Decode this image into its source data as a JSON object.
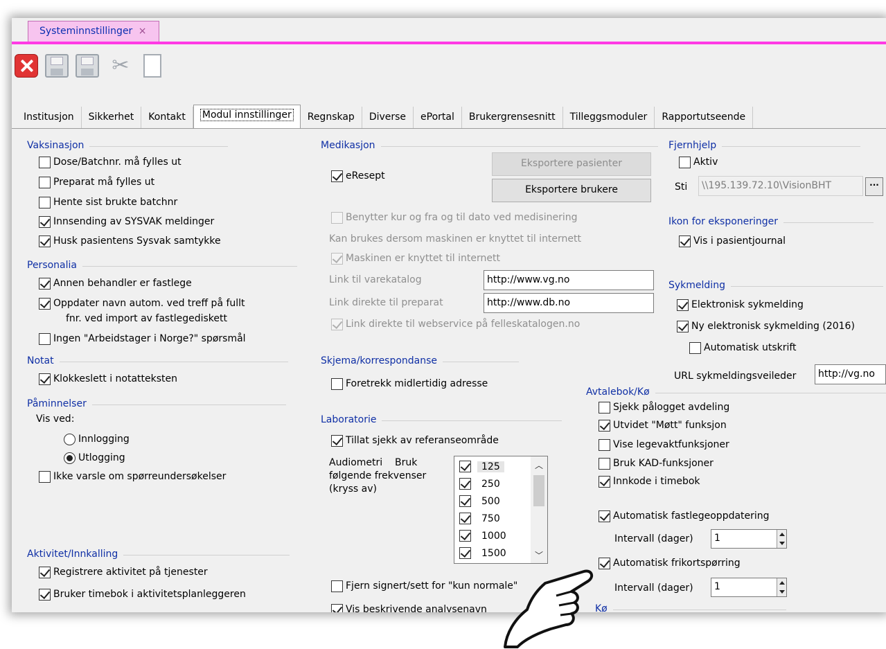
{
  "window": {
    "tab_title": "Systeminnstillinger",
    "tab_close": "×"
  },
  "toolbar": {
    "close_icon": "close-icon",
    "save_icon": "save-icon",
    "save_close_icon": "save-close-icon",
    "cut_icon": "scissors-icon",
    "new_icon": "new-document-icon"
  },
  "tabs": [
    {
      "label": "Institusjon"
    },
    {
      "label": "Sikkerhet"
    },
    {
      "label": "Kontakt"
    },
    {
      "label": "Modul innstillinger"
    },
    {
      "label": "Regnskap"
    },
    {
      "label": "Diverse"
    },
    {
      "label": "ePortal"
    },
    {
      "label": "Brukergrensesnitt"
    },
    {
      "label": "Tilleggsmoduler"
    },
    {
      "label": "Rapportutseende"
    }
  ],
  "vaksinasjon": {
    "title": "Vaksinasjon",
    "items": [
      {
        "label": "Dose/Batchnr. må fylles ut",
        "checked": false
      },
      {
        "label": "Preparat må fylles ut",
        "checked": false
      },
      {
        "label": "Hente sist brukte batchnr",
        "checked": false
      },
      {
        "label": "Innsending av SYSVAK meldinger",
        "checked": true
      },
      {
        "label": "Husk pasientens Sysvak samtykke",
        "checked": true
      }
    ]
  },
  "personalia": {
    "title": "Personalia",
    "items": [
      {
        "label": "Annen behandler er fastlege",
        "checked": true
      },
      {
        "label": "Oppdater navn autom. ved treff på fullt",
        "label2": "fnr. ved import av fastlegediskett",
        "checked": true
      },
      {
        "label": "Ingen \"Arbeidstager i Norge?\" spørsmål",
        "checked": false
      }
    ]
  },
  "notat": {
    "title": "Notat",
    "items": [
      {
        "label": "Klokkeslett i notatteksten",
        "checked": true
      }
    ]
  },
  "paminnelser": {
    "title": "Påminnelser",
    "vis_ved": "Vis ved:",
    "radios": [
      {
        "label": "Innlogging",
        "checked": false
      },
      {
        "label": "Utlogging",
        "checked": true
      }
    ],
    "ikke_varsle": "Ikke varsle om spørreundersøkelser"
  },
  "aktivitet": {
    "title": "Aktivitet/Innkalling",
    "items": [
      {
        "label": "Registrere aktivitet på tjenester",
        "checked": true
      },
      {
        "label": "Bruker timebok i aktivitetsplanleggeren",
        "checked": true
      }
    ]
  },
  "medikasjon": {
    "title": "Medikasjon",
    "eresept": "eResept",
    "export_pasienter": "Eksportere pasienter",
    "export_brukere": "Eksportere brukere",
    "kur": "Benytter kur og fra og til dato ved medisinering",
    "internett_note": "Kan brukes dersom maskinen er knyttet til internett",
    "internett": "Maskinen er knyttet til internett",
    "link_varekatalog_label": "Link til varekatalog",
    "link_varekatalog_value": "http://www.vg.no",
    "link_preparat_label": "Link direkte til preparat",
    "link_preparat_value": "http://www.db.no",
    "webservice": "Link direkte til webservice på felleskatalogen.no"
  },
  "skjema": {
    "title": "Skjema/korrespondanse",
    "foretrekk": "Foretrekk midlertidig adresse"
  },
  "laboratorie": {
    "title": "Laboratorie",
    "tillat": "Tillat sjekk av referanseområde",
    "audiometri_1": "Audiometri    Bruk",
    "audiometri_2": "følgende frekvenser",
    "audiometri_3": "(kryss av)",
    "frekvenser": [
      {
        "label": "125",
        "checked": true
      },
      {
        "label": "250",
        "checked": true
      },
      {
        "label": "500",
        "checked": true
      },
      {
        "label": "750",
        "checked": true
      },
      {
        "label": "1000",
        "checked": true
      },
      {
        "label": "1500",
        "checked": true
      }
    ],
    "fjern": "Fjern signert/sett for \"kun normale\"",
    "vis_beskrivende": "Vis beskrivende analysenavn"
  },
  "fjernhjelp": {
    "title": "Fjernhjelp",
    "aktiv": "Aktiv",
    "sti_label": "Sti",
    "sti_value": "\\\\195.139.72.10\\VisionBHT",
    "browse": "..."
  },
  "ikon": {
    "title": "Ikon for eksponeringer",
    "vis": "Vis i pasientjournal"
  },
  "sykmelding": {
    "title": "Sykmelding",
    "elektronisk": "Elektronisk sykmelding",
    "ny": "Ny elektronisk sykmelding (2016)",
    "utskrift": "Automatisk utskrift",
    "url_label": "URL sykmeldingsveileder",
    "url_value": "http://vg.no"
  },
  "avtalebok": {
    "title": "Avtalebok/Kø",
    "items": [
      {
        "label": "Sjekk pålogget avdeling",
        "checked": false
      },
      {
        "label": "Utvidet \"Møtt\" funksjon",
        "checked": true
      },
      {
        "label": "Vise legevaktfunksjoner",
        "checked": false
      },
      {
        "label": "Bruk KAD-funksjoner",
        "checked": false
      },
      {
        "label": "Innkode i timebok",
        "checked": true
      }
    ],
    "fastlege": "Automatisk fastlegeoppdatering",
    "intervall1_label": "Intervall (dager)",
    "intervall1_value": "1",
    "frikort": "Automatisk frikortspørring",
    "intervall2_label": "Intervall (dager)",
    "intervall2_value": "1"
  },
  "ko": {
    "title": "Kø"
  }
}
